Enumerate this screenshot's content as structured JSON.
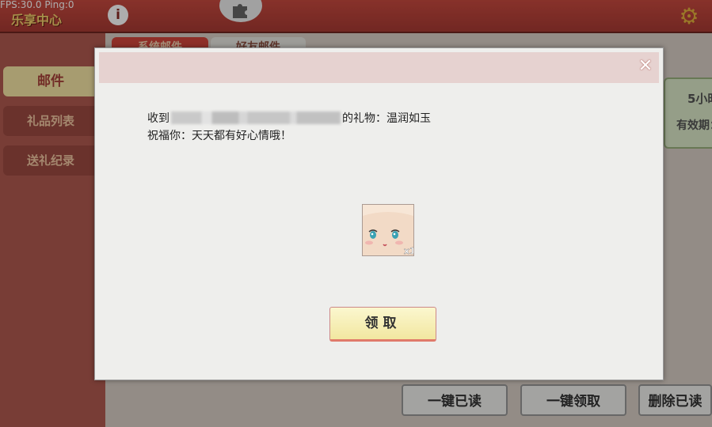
{
  "debug": {
    "fps_text": "FPS:30.0  Ping:0"
  },
  "header": {
    "game_title": "乐享中心",
    "info_icon": "i"
  },
  "sidebar": {
    "items": [
      {
        "label": "邮件",
        "active": true
      },
      {
        "label": "礼品列表",
        "active": false
      },
      {
        "label": "送礼纪录",
        "active": false
      }
    ]
  },
  "tabs": [
    {
      "label": "系统邮件",
      "active": true
    },
    {
      "label": "好友邮件",
      "active": false
    }
  ],
  "mail_card": {
    "time_text": "5小时",
    "expire_text": "有效期："
  },
  "bottom_buttons": {
    "mark_all_read": "一键已读",
    "claim_all": "一键领取",
    "delete_read": "删除已读"
  },
  "modal": {
    "message_prefix": "收到",
    "message_suffix": "的礼物：温润如玉",
    "blessing": "祝福你：天天都有好心情哦！",
    "claim_label": "领取",
    "gift_count": "x1"
  }
}
